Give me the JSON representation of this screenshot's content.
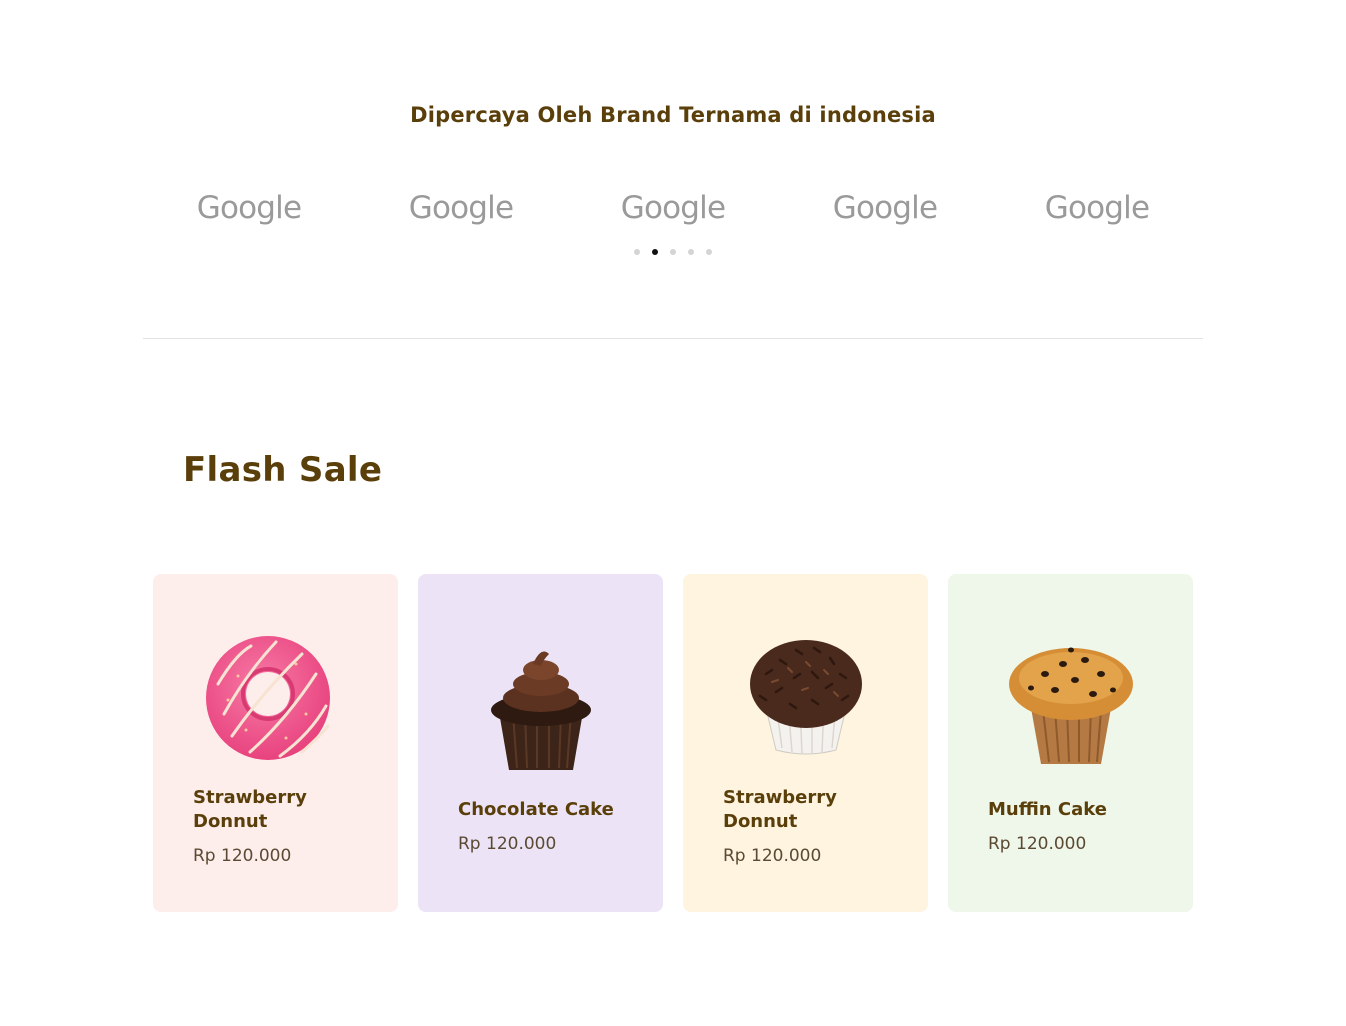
{
  "trusted": {
    "title": "Dipercaya Oleh Brand Ternama di indonesia",
    "logos": [
      "Google",
      "Google",
      "Google",
      "Google",
      "Google"
    ],
    "carousel": {
      "dot_count": 5,
      "active_dot_index": 1
    }
  },
  "flash_sale": {
    "title": "Flash Sale",
    "products": [
      {
        "name": "Strawberry Donnut",
        "price": "Rp 120.000",
        "bg": "#fdeeec",
        "image": "pink-donut-image"
      },
      {
        "name": "Chocolate Cake",
        "price": "Rp 120.000",
        "bg": "#ece4f6",
        "image": "chocolate-cupcake-image"
      },
      {
        "name": "Strawberry Donnut",
        "price": "Rp 120.000",
        "bg": "#fef4df",
        "image": "chocolate-sprinkle-cake-image"
      },
      {
        "name": "Muffin Cake",
        "price": "Rp 120.000",
        "bg": "#eef7e9",
        "image": "muffin-image"
      }
    ]
  }
}
